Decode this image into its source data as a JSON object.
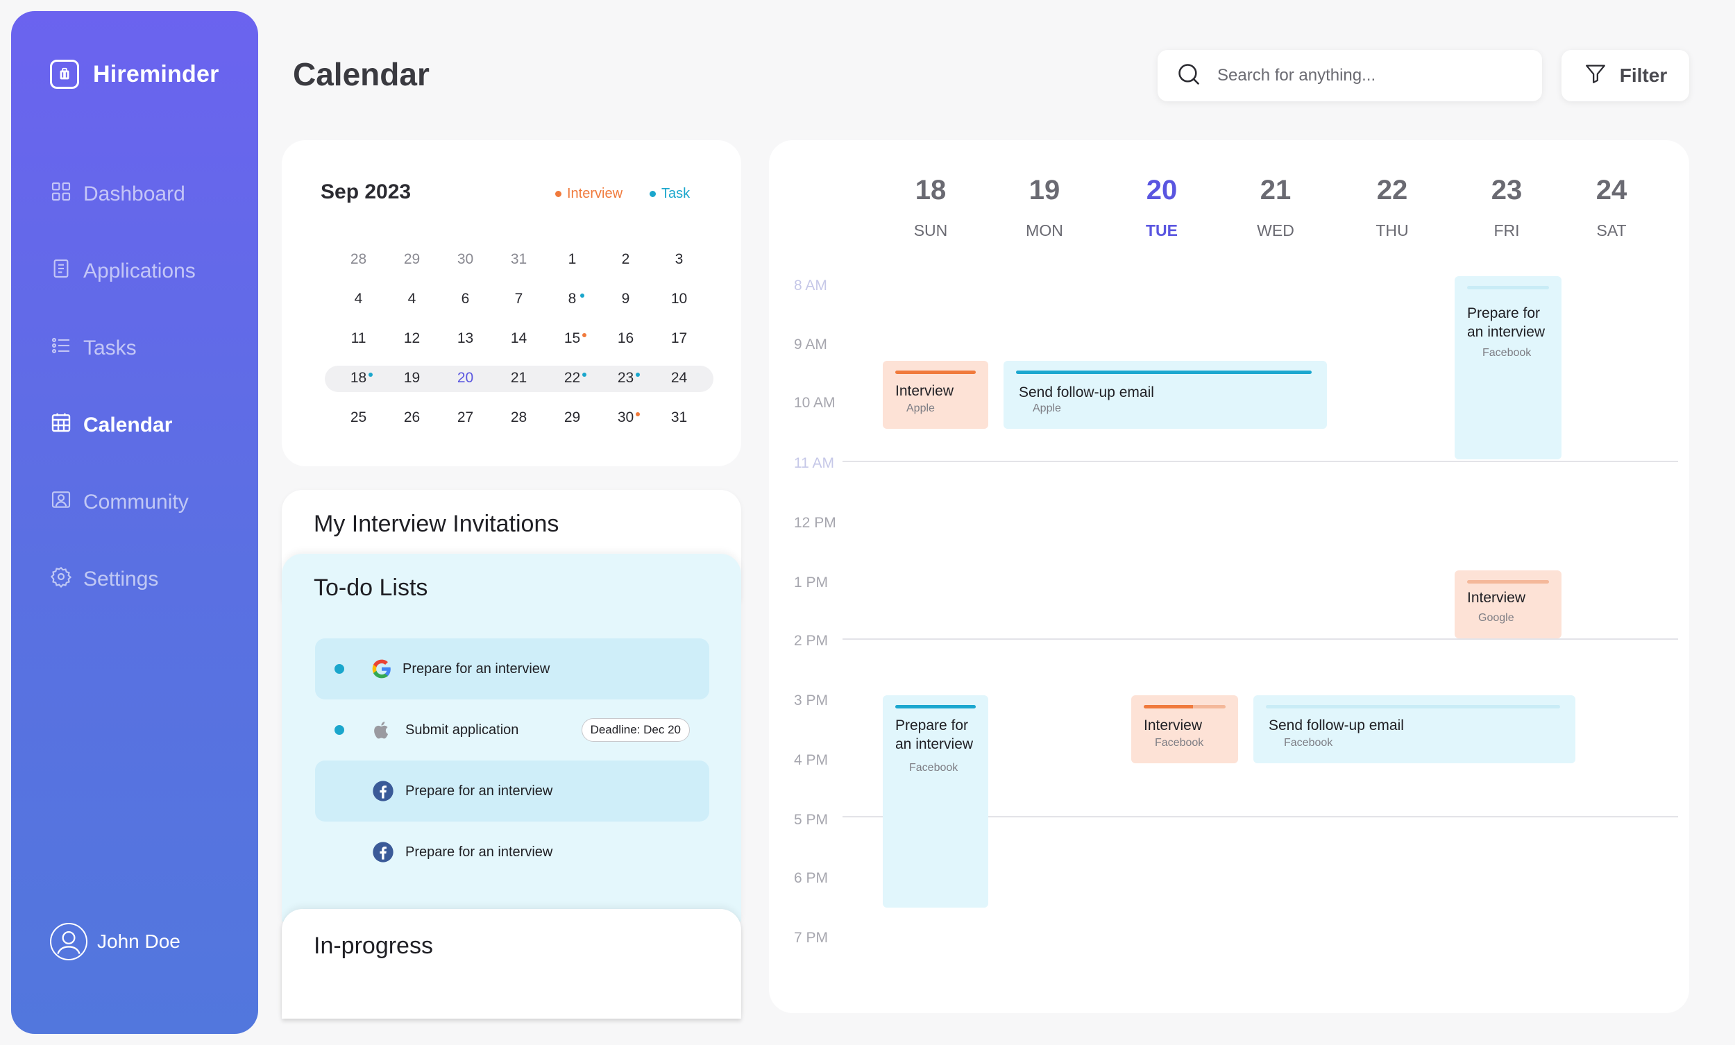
{
  "app": {
    "name": "Hireminder"
  },
  "nav": [
    {
      "label": "Dashboard",
      "icon": "dashboard-icon",
      "active": false
    },
    {
      "label": "Applications",
      "icon": "applications-icon",
      "active": false
    },
    {
      "label": "Tasks",
      "icon": "tasks-icon",
      "active": false
    },
    {
      "label": "Calendar",
      "icon": "calendar-icon",
      "active": true
    },
    {
      "label": "Community",
      "icon": "community-icon",
      "active": false
    },
    {
      "label": "Settings",
      "icon": "settings-icon",
      "active": false
    }
  ],
  "user": {
    "name": "John Doe"
  },
  "header": {
    "title": "Calendar",
    "search_placeholder": "Search for anything...",
    "filter_label": "Filter"
  },
  "mini_calendar": {
    "month": "Sep 2023",
    "legend": [
      {
        "label": "Interview",
        "color": "#f07a3c"
      },
      {
        "label": "Task",
        "color": "#1aa6cc"
      }
    ],
    "weeks": [
      [
        "28",
        "29",
        "30",
        "31",
        "1",
        "2",
        "3"
      ],
      [
        "4",
        "4",
        "6",
        "7",
        "8",
        "9",
        "10"
      ],
      [
        "11",
        "12",
        "13",
        "14",
        "15",
        "16",
        "17"
      ],
      [
        "18",
        "19",
        "20",
        "21",
        "22",
        "23",
        "24"
      ],
      [
        "25",
        "26",
        "27",
        "28",
        "29",
        "30",
        "31"
      ]
    ]
  },
  "invitations": {
    "title": "My Interview Invitations"
  },
  "todo": {
    "title": "To-do Lists",
    "items": [
      {
        "text": "Prepare for an interview",
        "logo": "google-icon"
      },
      {
        "text": "Submit application",
        "logo": "apple-icon",
        "deadline": "Deadline: Dec 20"
      },
      {
        "text": "Prepare for an interview",
        "logo": "facebook-icon"
      },
      {
        "text": "Prepare for an interview",
        "logo": "facebook-icon"
      }
    ]
  },
  "inprogress": {
    "title": "In-progress"
  },
  "week": {
    "days": [
      {
        "num": "18",
        "name": "SUN"
      },
      {
        "num": "19",
        "name": "MON"
      },
      {
        "num": "20",
        "name": "TUE"
      },
      {
        "num": "21",
        "name": "WED"
      },
      {
        "num": "22",
        "name": "THU"
      },
      {
        "num": "23",
        "name": "FRI"
      },
      {
        "num": "24",
        "name": "SAT"
      }
    ],
    "times": [
      "8 AM",
      "9 AM",
      "10 AM",
      "11 AM",
      "12 PM",
      "1 PM",
      "2 PM",
      "3 PM",
      "4 PM",
      "5 PM",
      "6 PM",
      "7 PM"
    ],
    "events": [
      {
        "title": "Interview",
        "company": "Apple"
      },
      {
        "title": "Send follow-up email",
        "company": "Apple"
      },
      {
        "title": "Prepare for\nan interview",
        "company": "Facebook"
      },
      {
        "title": "Interview",
        "company": "Google"
      },
      {
        "title": "Prepare for\nan interview",
        "company": "Facebook"
      },
      {
        "title": "Interview",
        "company": "Facebook"
      },
      {
        "title": "Send follow-up email",
        "company": "Facebook"
      }
    ]
  }
}
